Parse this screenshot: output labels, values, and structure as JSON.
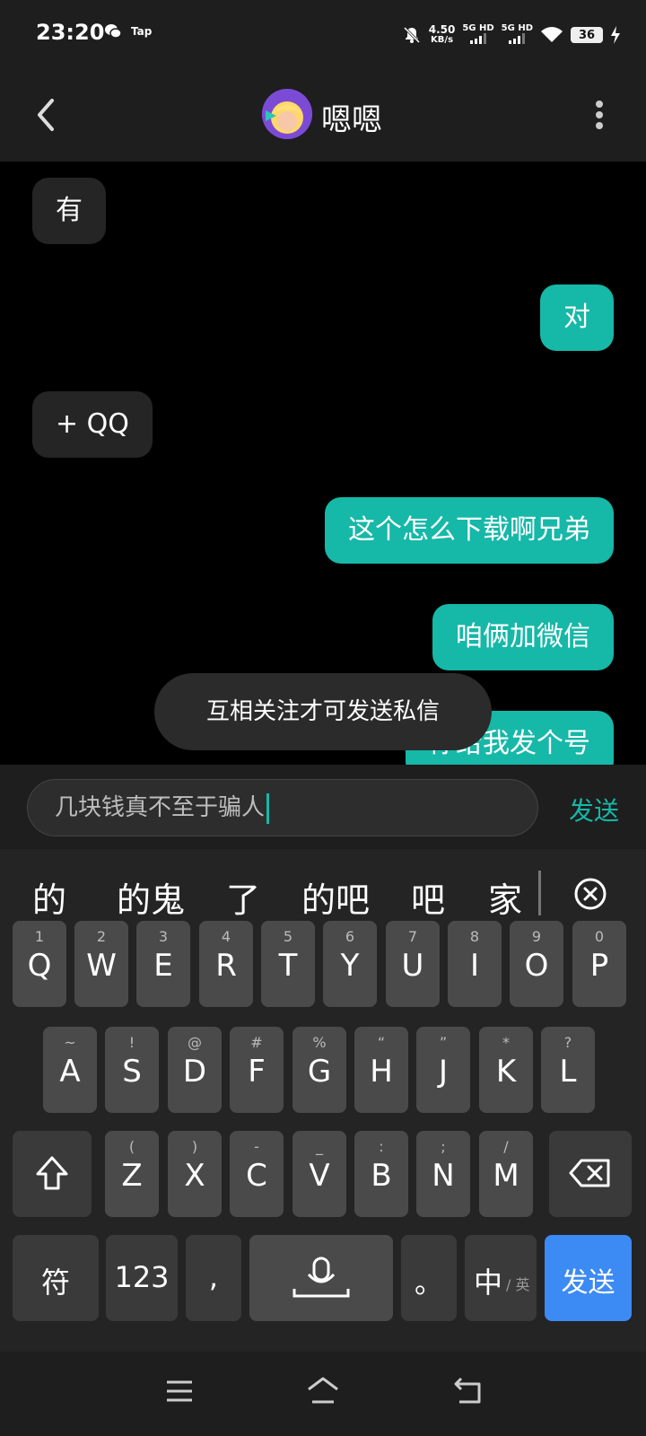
{
  "status_bar": {
    "time": "23:20",
    "tap_label": "Tap",
    "net_speed_value": "4.50",
    "net_speed_unit": "KB/s",
    "signal1": "5G HD",
    "signal2": "5G HD",
    "battery": "36"
  },
  "header": {
    "title": "嗯嗯"
  },
  "messages": [
    {
      "side": "in",
      "text": "有"
    },
    {
      "side": "out",
      "text": "对"
    },
    {
      "side": "in",
      "text": "+ QQ"
    },
    {
      "side": "out",
      "text": "这个怎么下载啊兄弟"
    },
    {
      "side": "out",
      "text": "咱俩加微信"
    },
    {
      "side": "out",
      "text": "你给我发个号"
    }
  ],
  "toast": "互相关注才可发送私信",
  "input": {
    "value": "几块钱真不至于骗人",
    "send_label": "发送"
  },
  "keyboard": {
    "candidates": [
      "的",
      "的鬼",
      "了",
      "的吧",
      "吧",
      "家"
    ],
    "row1": [
      {
        "main": "Q",
        "sub": "1"
      },
      {
        "main": "W",
        "sub": "2"
      },
      {
        "main": "E",
        "sub": "3"
      },
      {
        "main": "R",
        "sub": "4"
      },
      {
        "main": "T",
        "sub": "5"
      },
      {
        "main": "Y",
        "sub": "6"
      },
      {
        "main": "U",
        "sub": "7"
      },
      {
        "main": "I",
        "sub": "8"
      },
      {
        "main": "O",
        "sub": "9"
      },
      {
        "main": "P",
        "sub": "0"
      }
    ],
    "row2": [
      {
        "main": "A",
        "sub": "~"
      },
      {
        "main": "S",
        "sub": "!"
      },
      {
        "main": "D",
        "sub": "@"
      },
      {
        "main": "F",
        "sub": "#"
      },
      {
        "main": "G",
        "sub": "%"
      },
      {
        "main": "H",
        "sub": "“"
      },
      {
        "main": "J",
        "sub": "”"
      },
      {
        "main": "K",
        "sub": "*"
      },
      {
        "main": "L",
        "sub": "?"
      }
    ],
    "row3": [
      {
        "main": "Z",
        "sub": "("
      },
      {
        "main": "X",
        "sub": ")"
      },
      {
        "main": "C",
        "sub": "-"
      },
      {
        "main": "V",
        "sub": "_"
      },
      {
        "main": "B",
        "sub": ":"
      },
      {
        "main": "N",
        "sub": ";"
      },
      {
        "main": "M",
        "sub": "/"
      }
    ],
    "symbols_label": "符",
    "numbers_label": "123",
    "comma_label": ",",
    "period_label": "。",
    "lang_main": "中",
    "lang_sub": "/ 英",
    "send_label": "发送"
  }
}
